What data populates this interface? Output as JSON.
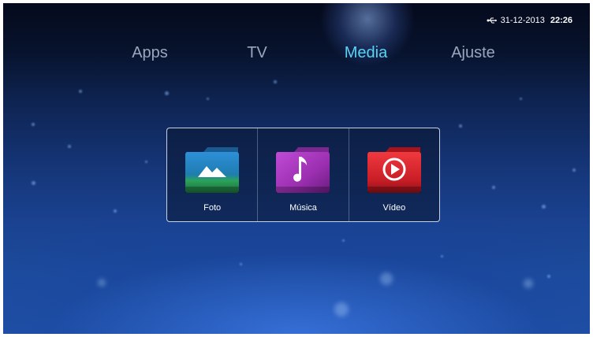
{
  "status": {
    "date": "31-12-2013",
    "time": "22:26",
    "icon": "usb-icon"
  },
  "nav": {
    "tabs": [
      {
        "label": "Apps",
        "active": false
      },
      {
        "label": "TV",
        "active": false
      },
      {
        "label": "Media",
        "active": true
      },
      {
        "label": "Ajuste",
        "active": false
      }
    ],
    "active_color": "#5ad2f4",
    "inactive_color": "#9aa6bb"
  },
  "media": {
    "tiles": [
      {
        "label": "Foto",
        "icon": "photo-folder-icon",
        "color": "#2f9e5a"
      },
      {
        "label": "Música",
        "icon": "music-folder-icon",
        "color": "#a83bbf"
      },
      {
        "label": "Vídeo",
        "icon": "video-folder-icon",
        "color": "#d9252e"
      }
    ]
  }
}
